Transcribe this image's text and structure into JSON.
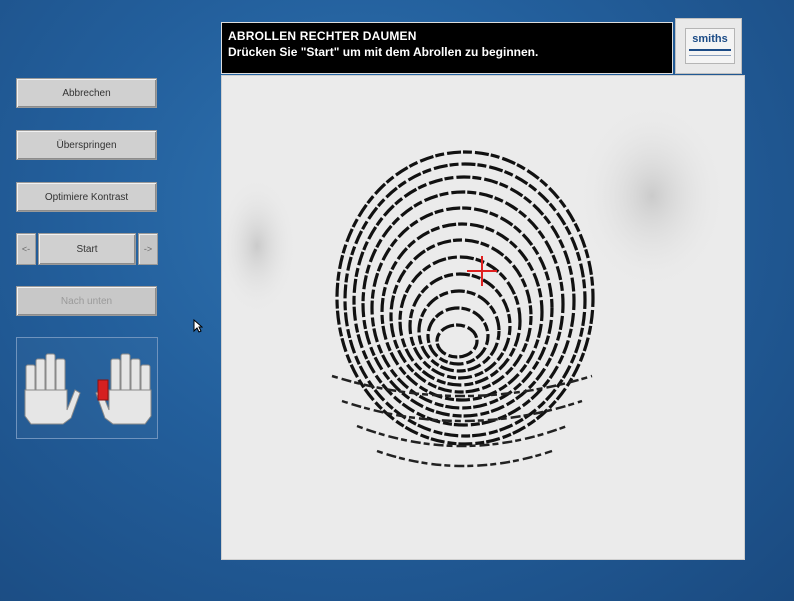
{
  "header": {
    "title": "ABROLLEN RECHTER DAUMEN",
    "message": "Drücken Sie \"Start\" um mit dem Abrollen zu beginnen."
  },
  "logo": {
    "text": "smiths"
  },
  "buttons": {
    "cancel": "Abbrechen",
    "skip": "Überspringen",
    "optimize": "Optimiere Kontrast",
    "prev": "<-",
    "start": "Start",
    "next": "->",
    "move_down": "Nach unten"
  },
  "hands": {
    "left_icon": "left-hand-icon",
    "right_icon": "right-hand-icon",
    "selected_finger": "right thumb",
    "selected_color": "#d62020"
  },
  "scan": {
    "fingerprint_icon": "fingerprint-icon",
    "crosshair_icon": "crosshair-icon",
    "crosshair_color": "#e02020"
  }
}
